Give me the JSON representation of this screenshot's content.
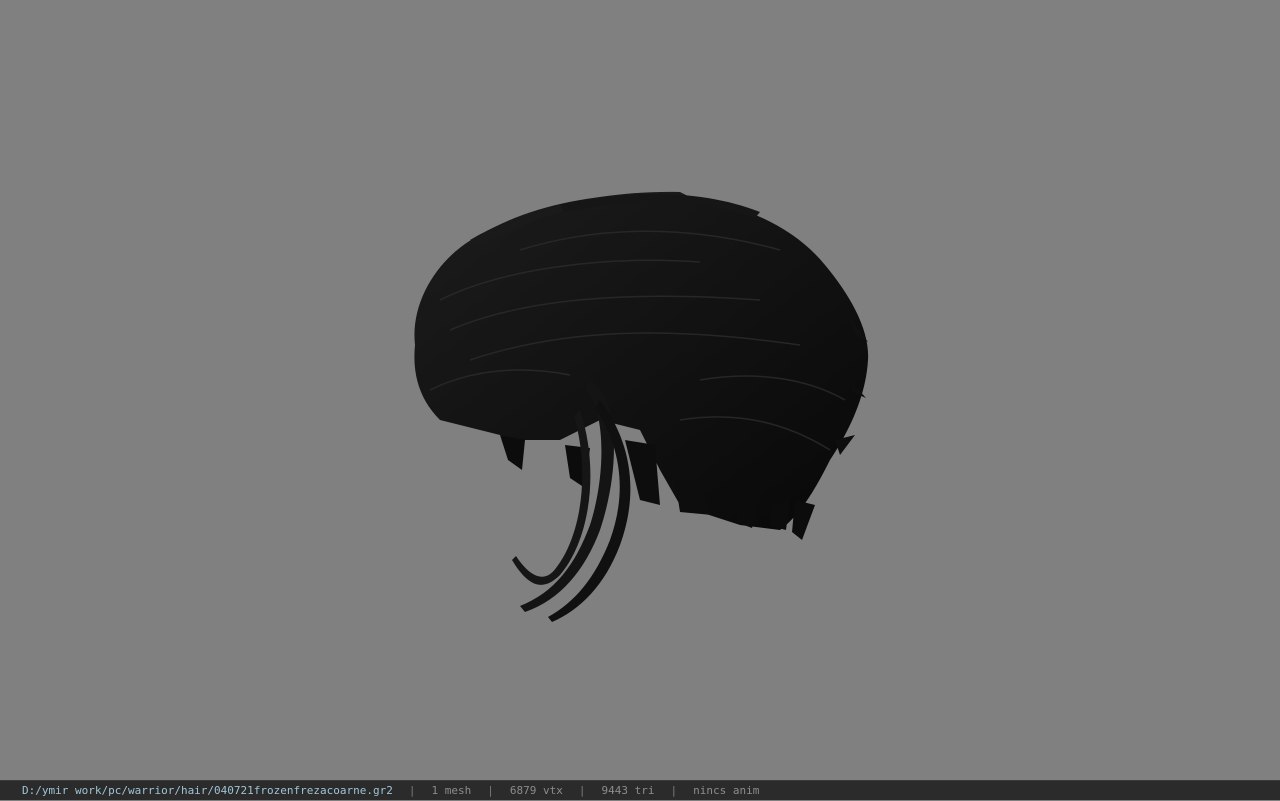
{
  "viewport": {
    "background": "#808080",
    "model_icon": "hair-mesh-icon"
  },
  "statusbar": {
    "path": "D:/ymir work/pc/warrior/hair/040721frozenfrezacoarne.gr2",
    "separator": "|",
    "mesh": "1 mesh",
    "vtx": "6879 vtx",
    "tri": "9443 tri",
    "anim": "nincs anim",
    "path_color": "#9fc3d4"
  }
}
